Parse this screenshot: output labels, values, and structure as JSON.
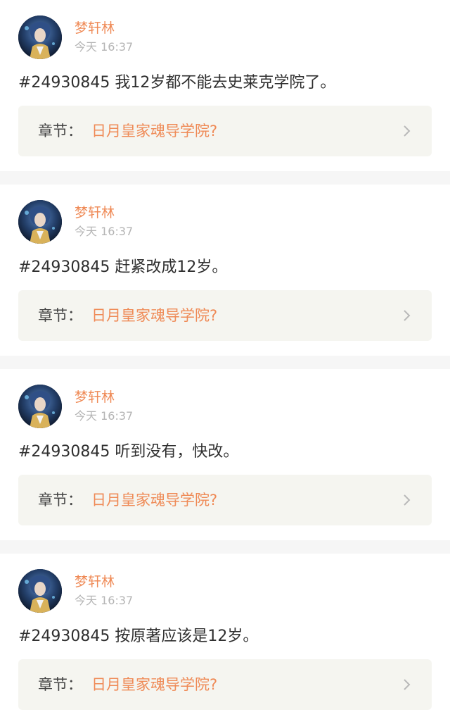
{
  "comments": [
    {
      "author": "梦轩林",
      "time": "今天 16:37",
      "text": "#24930845 我12岁都不能去史莱克学院了。",
      "chapter_label": "章节：",
      "chapter_title": "日月皇家魂导学院?"
    },
    {
      "author": "梦轩林",
      "time": "今天 16:37",
      "text": "#24930845 赶紧改成12岁。",
      "chapter_label": "章节：",
      "chapter_title": "日月皇家魂导学院?"
    },
    {
      "author": "梦轩林",
      "time": "今天 16:37",
      "text": "#24930845 听到没有，快改。",
      "chapter_label": "章节：",
      "chapter_title": "日月皇家魂导学院?"
    },
    {
      "author": "梦轩林",
      "time": "今天 16:37",
      "text": "#24930845 按原著应该是12岁。",
      "chapter_label": "章节：",
      "chapter_title": "日月皇家魂导学院?"
    }
  ],
  "colors": {
    "accent": "#ef8a56",
    "chapter_box_bg": "#f5f5f0",
    "divider_bg": "#f6f6f6"
  },
  "icons": {
    "chevron": "chevron-right-icon"
  }
}
